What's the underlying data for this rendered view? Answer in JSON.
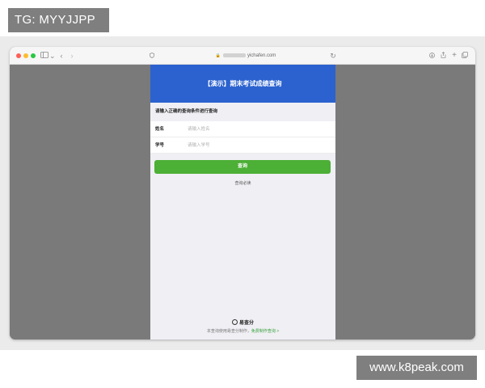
{
  "overlay": {
    "tg_label": "TG: MYYJJPP",
    "site_label": "www.k8peak.com"
  },
  "browser": {
    "address_text": "yichafen.com",
    "sidebar_icon": "sidebar-icon",
    "back_icon": "back-icon",
    "forward_icon": "forward-icon",
    "colors": {
      "traffic_red": "#ff5f57",
      "traffic_yellow": "#febc2e",
      "traffic_green": "#28c840"
    }
  },
  "page": {
    "header_title": "【演示】期末考试成绩查询",
    "hint": "请输入正确的查询条件进行查询",
    "fields": [
      {
        "label": "姓名",
        "placeholder": "请输入姓名",
        "value": ""
      },
      {
        "label": "学号",
        "placeholder": "请输入学号",
        "value": ""
      }
    ],
    "submit_label": "查询",
    "notice_link": "查询必读",
    "brand_name": "易查分",
    "footer_text": "本查询使用易查分制作，",
    "footer_link": "免费制作查询 >",
    "colors": {
      "header": "#2b62cf",
      "button": "#4caf36",
      "link": "#3aa23e"
    }
  }
}
